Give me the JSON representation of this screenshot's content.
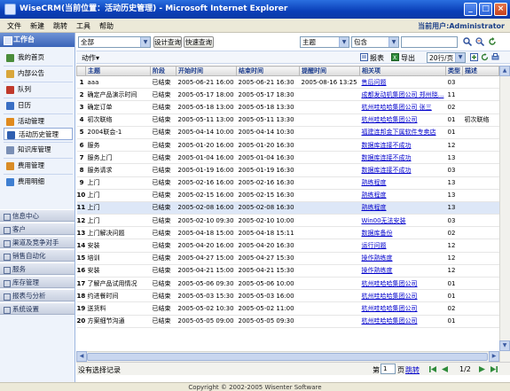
{
  "window": {
    "title": "WiseCRM(当前位置：活动历史管理) - Microsoft Internet Explorer",
    "controls": [
      "_",
      "□",
      "×"
    ]
  },
  "menubar": {
    "items": [
      "文件",
      "新建",
      "跳转",
      "工具",
      "帮助"
    ],
    "current_user": "当前用户:Administrator"
  },
  "sidebar": {
    "header": "工作台",
    "items": [
      {
        "label": "我的首页",
        "icon": "home-icon",
        "color": "#4a8c3a"
      },
      {
        "label": "内部公告",
        "icon": "notice-icon",
        "color": "#d9a63a"
      },
      {
        "label": "队列",
        "icon": "queue-icon",
        "color": "#c0392b"
      },
      {
        "label": "日历",
        "icon": "calendar-icon",
        "color": "#3a6fc4"
      },
      {
        "label": "活动管理",
        "icon": "activity-icon",
        "color": "#e08a1e"
      },
      {
        "label": "活动历史管理",
        "icon": "history-icon",
        "color": "#2f5fb0"
      },
      {
        "label": "知识库管理",
        "icon": "knowledge-icon",
        "color": "#7a8fb5"
      },
      {
        "label": "费用管理",
        "icon": "expense-icon",
        "color": "#d98c26"
      },
      {
        "label": "费用明细",
        "icon": "expense-detail-icon",
        "color": "#3f7fd1"
      }
    ],
    "groups": [
      "信息中心",
      "客户",
      "渠道及竞争对手",
      "销售自动化",
      "服务",
      "库存管理",
      "报表与分析",
      "系统设置"
    ]
  },
  "toolbar": {
    "filter_select": "全部",
    "design_query": "设计查询",
    "quick_query": "快速查询",
    "field_select": "主题",
    "operator_select": "包含",
    "search_value": ""
  },
  "actionbar": {
    "actions": "动作▾",
    "report": "报表",
    "export": "导出",
    "page_size": "20行/页"
  },
  "grid": {
    "columns": [
      "",
      "主题",
      "阶段",
      "开始时间",
      "结束时间",
      "提醒时间",
      "相关项",
      "类型",
      "描述"
    ],
    "rows": [
      [
        "1",
        "aaa",
        "已结束",
        "2005-06-21 16:00",
        "2005-06-21 16:30",
        "2005-08-16 13:25",
        "售后问题",
        "03",
        ""
      ],
      [
        "2",
        "确定产品演示时间",
        "已结束",
        "2005-05-17 18:00",
        "2005-05-17 18:30",
        "",
        "成都发动机集团公司    郑州晓...",
        "11",
        ""
      ],
      [
        "3",
        "确定订单",
        "已结束",
        "2005-05-18 13:00",
        "2005-05-18 13:30",
        "",
        "杭州哇哈哈集团公司    张三",
        "02",
        ""
      ],
      [
        "4",
        "初次联络",
        "已结束",
        "2005-05-11 13:00",
        "2005-05-11 13:30",
        "",
        "杭州哇哈哈集团公司",
        "01",
        "初次联络"
      ],
      [
        "5",
        "2004联会-1",
        "已结束",
        "2005-04-14 10:00",
        "2005-04-14 10:30",
        "",
        "福建连邦金下属软件专卖店",
        "01",
        ""
      ],
      [
        "6",
        "服务",
        "已结束",
        "2005-01-20 16:00",
        "2005-01-20 16:30",
        "",
        "数据库连接不成功",
        "12",
        ""
      ],
      [
        "7",
        "服务上门",
        "已结束",
        "2005-01-04 16:00",
        "2005-01-04 16:30",
        "",
        "数据库连接不成功",
        "13",
        ""
      ],
      [
        "8",
        "服务请求",
        "已结束",
        "2005-01-19 16:00",
        "2005-01-19 16:30",
        "",
        "数据库连接不成功",
        "03",
        ""
      ],
      [
        "9",
        "上门",
        "已结束",
        "2005-02-16 16:00",
        "2005-02-16 16:30",
        "",
        "熟练程度",
        "13",
        ""
      ],
      [
        "10",
        "上门",
        "已结束",
        "2005-02-15 16:00",
        "2005-02-15 16:30",
        "",
        "熟练程度",
        "13",
        ""
      ],
      [
        "11",
        "上门",
        "已结束",
        "2005-02-08 16:00",
        "2005-02-08 16:30",
        "",
        "熟练程度",
        "13",
        ""
      ],
      [
        "12",
        "上门",
        "已结束",
        "2005-02-10 09:30",
        "2005-02-10 10:00",
        "",
        "Win00无法安装",
        "03",
        ""
      ],
      [
        "13",
        "上门解决问题",
        "已结束",
        "2005-04-18 15:00",
        "2005-04-18 15:11",
        "",
        "数据库备份",
        "02",
        ""
      ],
      [
        "14",
        "安装",
        "已结束",
        "2005-04-20 16:00",
        "2005-04-20 16:30",
        "",
        "运行问题",
        "12",
        ""
      ],
      [
        "15",
        "培训",
        "已结束",
        "2005-04-27 15:00",
        "2005-04-27 15:30",
        "",
        "操作熟练度",
        "12",
        ""
      ],
      [
        "16",
        "安装",
        "已结束",
        "2005-04-21 15:00",
        "2005-04-21 15:30",
        "",
        "操作熟练度",
        "12",
        ""
      ],
      [
        "17",
        "了解产品试用情况",
        "已结束",
        "2005-05-06 09:30",
        "2005-05-06 10:00",
        "",
        "杭州哇哈哈集团公司",
        "01",
        ""
      ],
      [
        "18",
        "约进餐时间",
        "已结束",
        "2005-05-03 15:30",
        "2005-05-03 16:00",
        "",
        "杭州哇哈哈集团公司",
        "01",
        ""
      ],
      [
        "19",
        "送货料",
        "已结束",
        "2005-05-02 10:30",
        "2005-05-02 11:00",
        "",
        "杭州哇哈哈集团公司",
        "02",
        ""
      ],
      [
        "20",
        "方案细节沟通",
        "已结束",
        "2005-05-05 09:00",
        "2005-05-05 09:30",
        "",
        "杭州哇哈哈集团公司",
        "01",
        ""
      ]
    ]
  },
  "pager": {
    "status": "没有选择记录",
    "page_prefix": "第",
    "page_value": "1",
    "page_suffix": "页",
    "goto": "跳转",
    "page_info": "1/2"
  },
  "statusbar": {
    "copyright": "Copyright © 2002-2005 Wisenter Software"
  },
  "colors": {
    "title_blue": "#0a3fb8",
    "link": "#0000cc",
    "header_text": "#1a3b8c"
  }
}
